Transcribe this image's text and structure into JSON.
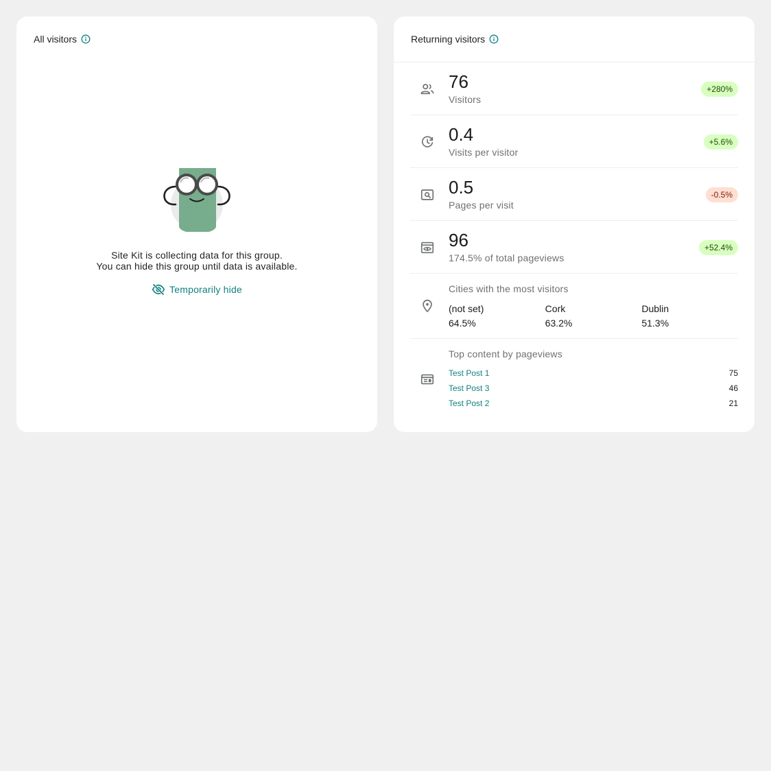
{
  "colors": {
    "background": "#f0f0f0",
    "card": "#ffffff",
    "accent": "#108080",
    "positive_badge_bg": "#d8ffc0",
    "negative_badge_bg": "#ffded3"
  },
  "all_visitors": {
    "title": "All visitors",
    "message_line1": "Site Kit is collecting data for this group.",
    "message_line2": "You can hide this group until data is available.",
    "hide_label": "Temporarily hide"
  },
  "returning_visitors": {
    "title": "Returning visitors",
    "metrics": [
      {
        "icon": "people-icon",
        "value": "76",
        "label": "Visitors",
        "change": "+280%",
        "trend": "up"
      },
      {
        "icon": "clock-history-icon",
        "value": "0.4",
        "label": "Visits per visitor",
        "change": "+5.6%",
        "trend": "up"
      },
      {
        "icon": "page-search-icon",
        "value": "0.5",
        "label": "Pages per visit",
        "change": "-0.5%",
        "trend": "down"
      },
      {
        "icon": "eye-page-icon",
        "value": "96",
        "label": "174.5% of total pageviews",
        "change": "+52.4%",
        "trend": "up"
      }
    ],
    "cities": {
      "label": "Cities with the most visitors",
      "items": [
        {
          "name": "(not set)",
          "value": "64.5%"
        },
        {
          "name": "Cork",
          "value": "63.2%"
        },
        {
          "name": "Dublin",
          "value": "51.3%"
        }
      ]
    },
    "top_content": {
      "label": "Top content by pageviews",
      "items": [
        {
          "title": "Test Post 1",
          "value": "75"
        },
        {
          "title": "Test Post 3",
          "value": "46"
        },
        {
          "title": "Test Post 2",
          "value": "21"
        }
      ]
    }
  }
}
